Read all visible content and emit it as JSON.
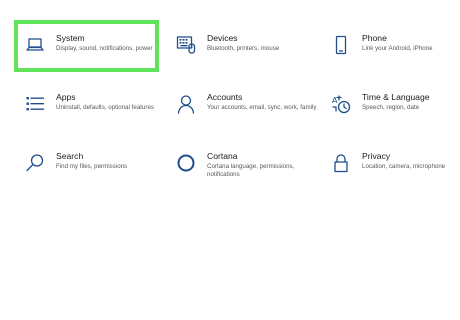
{
  "tiles": [
    {
      "title": "System",
      "desc": "Display, sound, notifications, power",
      "icon": "laptop-icon"
    },
    {
      "title": "Devices",
      "desc": "Bluetooth, printers, mouse",
      "icon": "keyboard-devices-icon"
    },
    {
      "title": "Phone",
      "desc": "Link your Android, iPhone",
      "icon": "phone-icon"
    },
    {
      "title": "Apps",
      "desc": "Uninstall, defaults, optional features",
      "icon": "apps-list-icon"
    },
    {
      "title": "Accounts",
      "desc": "Your accounts, email, sync, work, family",
      "icon": "person-icon"
    },
    {
      "title": "Time & Language",
      "desc": "Speech, region, date",
      "icon": "time-language-icon"
    },
    {
      "title": "Search",
      "desc": "Find my files, permissions",
      "icon": "search-icon"
    },
    {
      "title": "Cortana",
      "desc": "Cortana language, permissions, notifications",
      "icon": "cortana-circle-icon"
    },
    {
      "title": "Privacy",
      "desc": "Location, camera, microphone",
      "icon": "lock-icon"
    }
  ],
  "colors": {
    "accent": "#1f4e8c",
    "highlight": "#5fe35a"
  }
}
